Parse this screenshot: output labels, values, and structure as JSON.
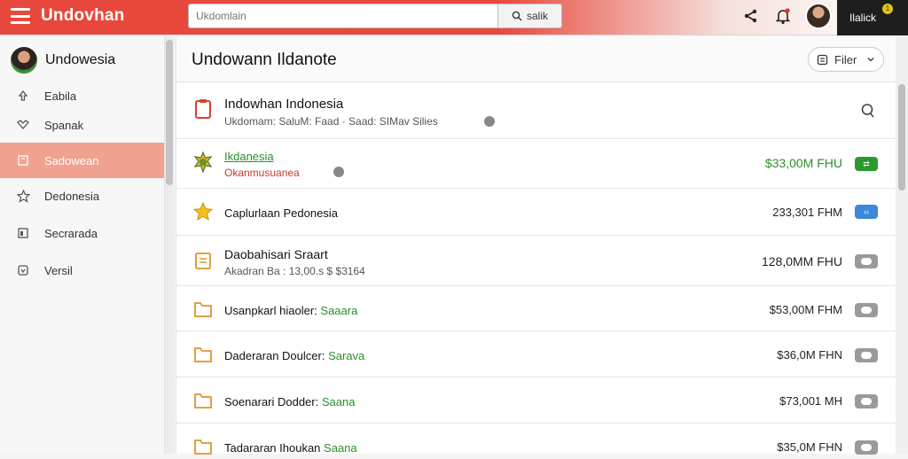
{
  "topbar": {
    "app_title": "Undovhan",
    "search_placeholder": "Ukdomlain",
    "search_button_label": "salik",
    "user_label": "Ilalick",
    "notification_count": "1"
  },
  "sidebar": {
    "profile_name": "Undowesia",
    "items": [
      {
        "label": "Eabila",
        "icon": "upload-icon"
      },
      {
        "label": "Spanak",
        "icon": "heart-icon"
      },
      {
        "label": "Sadowean",
        "icon": "document-icon",
        "active": true
      },
      {
        "label": "Dedonesia",
        "icon": "star-icon"
      },
      {
        "label": "Secrarada",
        "icon": "table-icon"
      },
      {
        "label": "Versil",
        "icon": "code-icon"
      }
    ]
  },
  "main": {
    "page_title": "Undowann Ildanote",
    "filter_label": "Filer",
    "rows": [
      {
        "title": "Indowhan Indonesia",
        "subtitle": "Ukdomam: SaluM: Faad · Saad: SIMav Silies",
        "icon": "document-icon"
      },
      {
        "title": "Ikdanesia",
        "subtitle": "Okanmusuanea",
        "amount": "$33,00M FHU",
        "icon": "badge-icon"
      },
      {
        "title": "Caplurlaan Pedonesia",
        "amount": "233,301 FHM",
        "icon": "star-icon"
      },
      {
        "title": "Daobahisari Sraart",
        "subtitle": "Akadran Ba : 13,00.s $ $3164",
        "amount": "128,0MM FHU",
        "icon": "file-icon"
      },
      {
        "title": "Usanpkarl hiaoler:",
        "highlight": "Saaara",
        "amount": "$53,00M FHM",
        "icon": "folder-icon"
      },
      {
        "title": "Daderaran Doulcer:",
        "highlight": "Sarava",
        "amount": "$36,0M FHN",
        "icon": "folder-icon"
      },
      {
        "title": "Soenarari Dodder:",
        "highlight": "Saana",
        "amount": "$73,001 MH",
        "icon": "folder-icon"
      },
      {
        "title": "Tadararan Ihoukan",
        "highlight": "Saana",
        "amount": "$35,0M FHN",
        "icon": "folder-icon"
      }
    ]
  }
}
